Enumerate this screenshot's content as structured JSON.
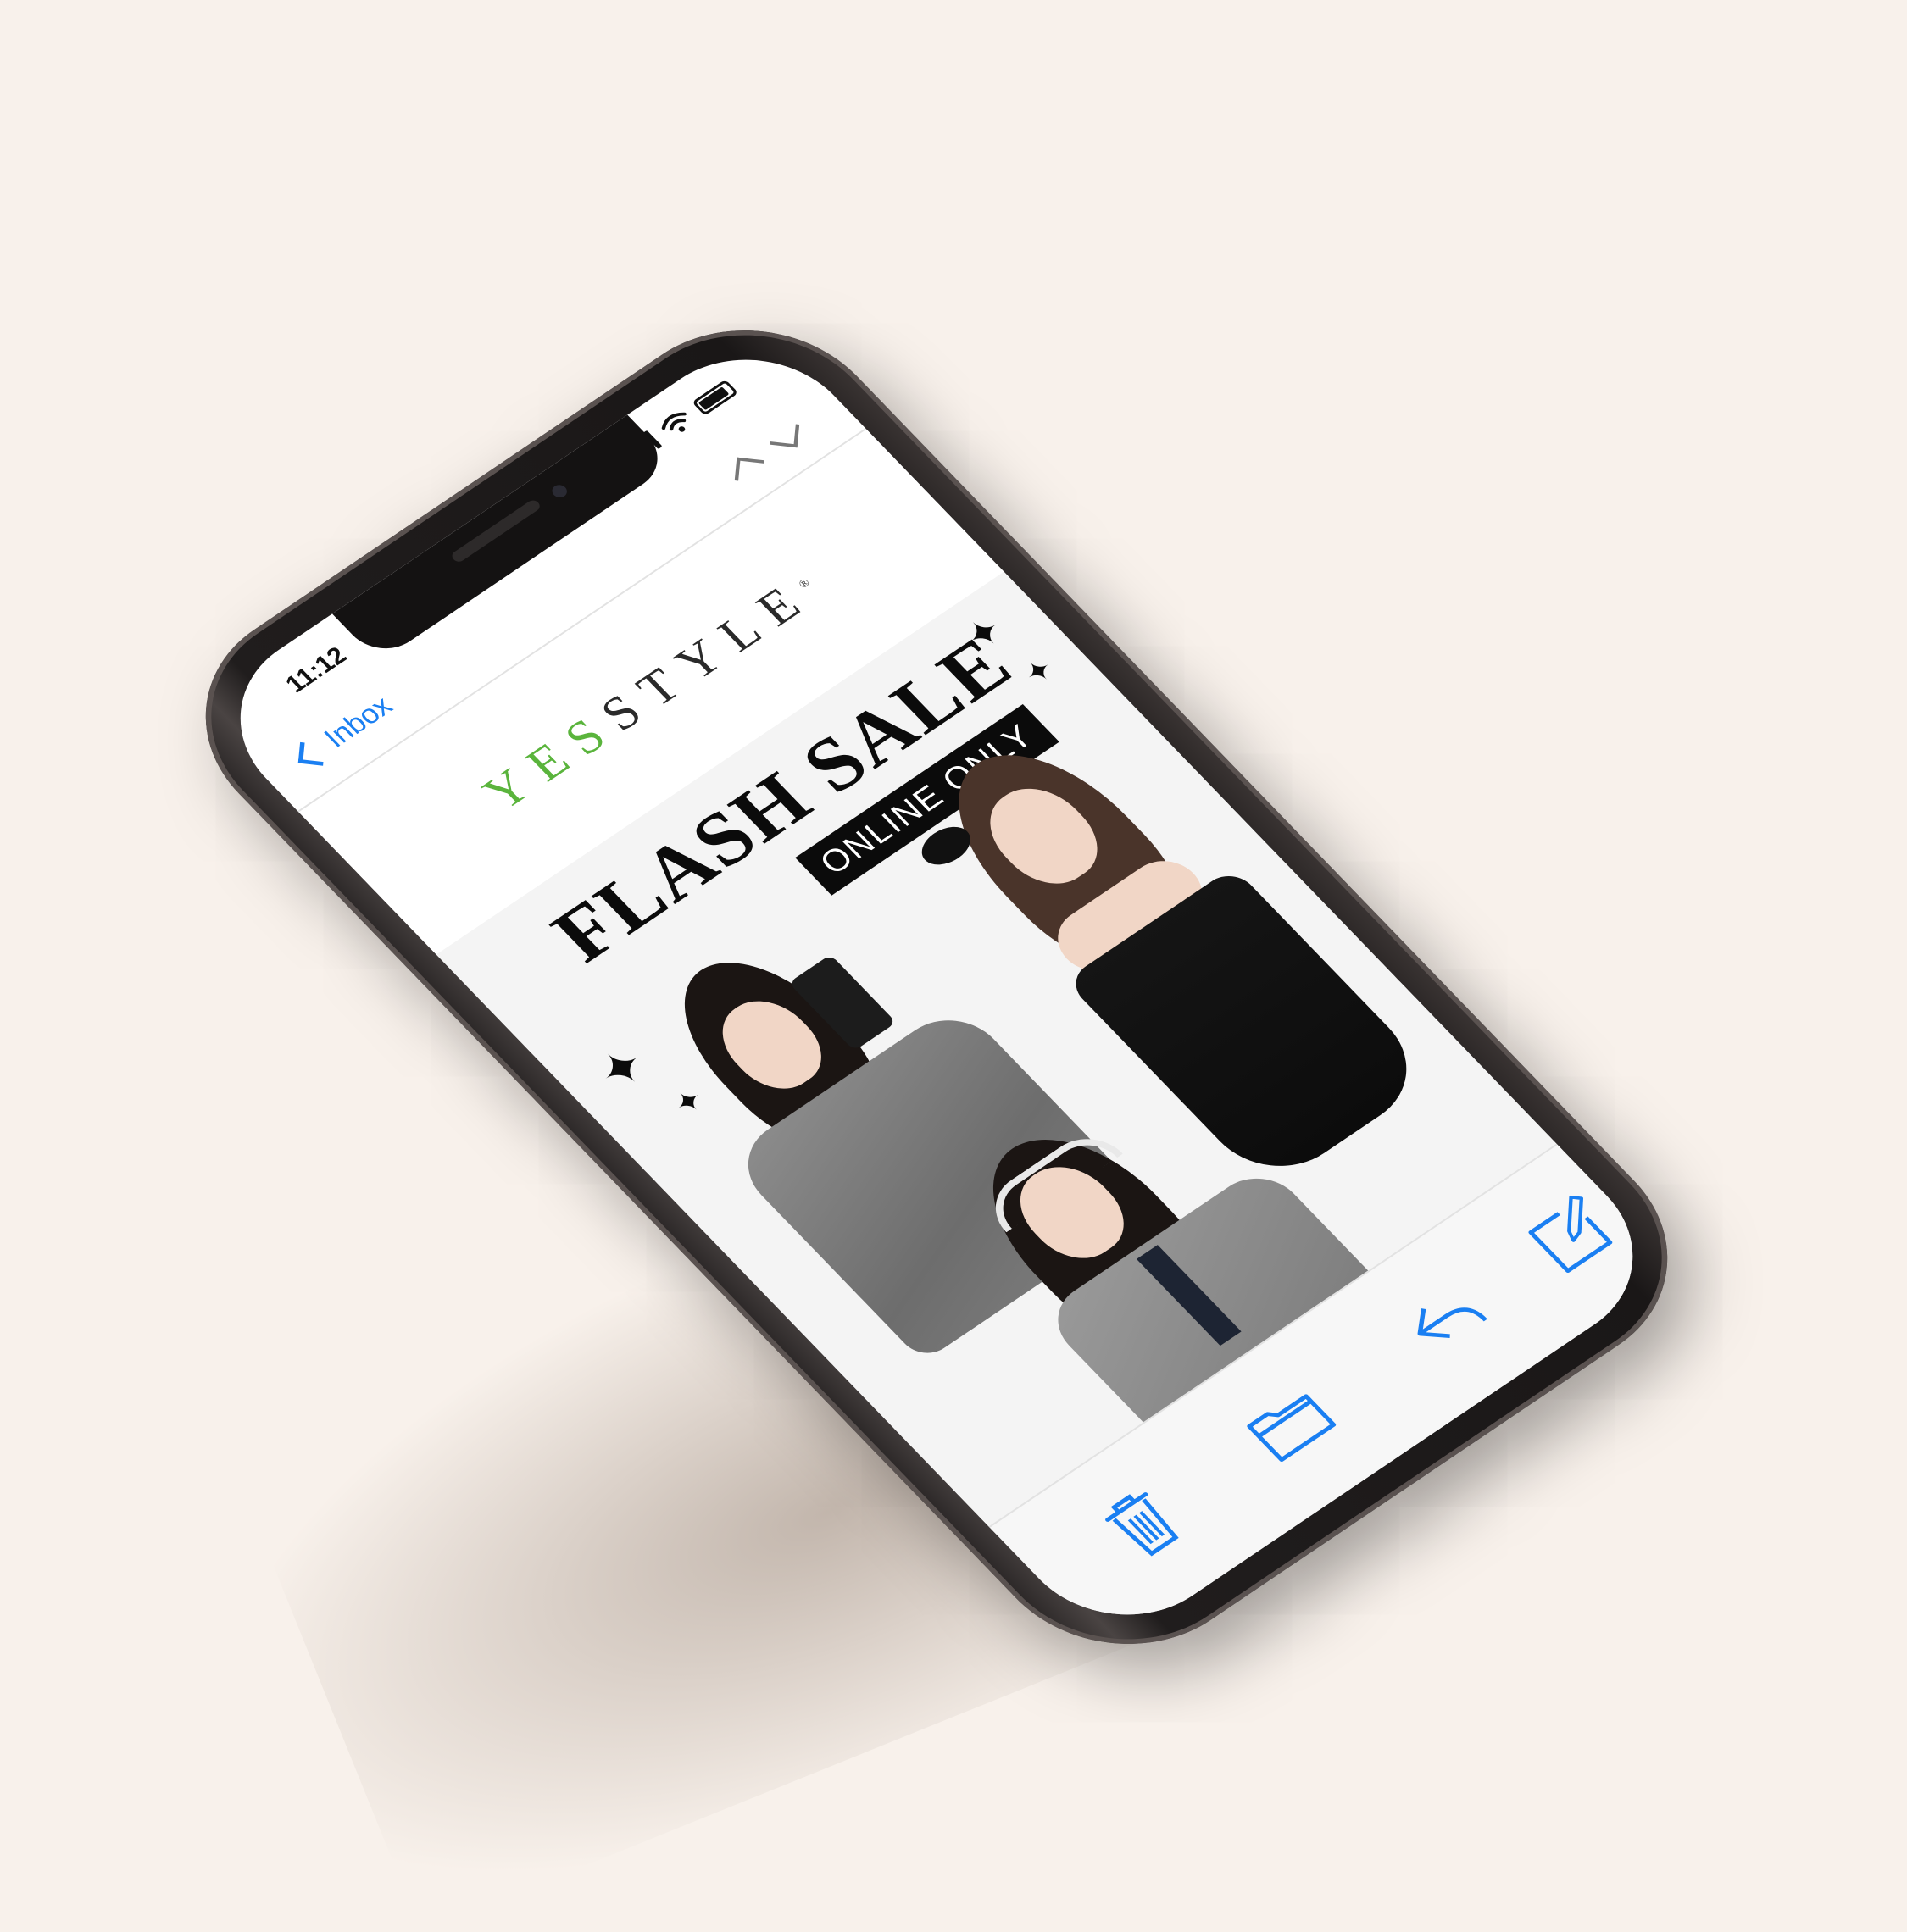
{
  "status": {
    "time": "11:12"
  },
  "nav": {
    "back_label": "Inbox"
  },
  "email": {
    "brand_yes": "YES",
    "brand_style": "STYLE",
    "brand_mark": "®",
    "headline": "FLASH SALE",
    "badge": "ONLINE ONLY"
  },
  "colors": {
    "accent": "#1a7ff2",
    "brand_green": "#5ab43c",
    "background": "#f8f1eb"
  },
  "toolbar": {
    "icons": [
      "trash-icon",
      "folder-icon",
      "reply-icon",
      "compose-icon"
    ]
  }
}
